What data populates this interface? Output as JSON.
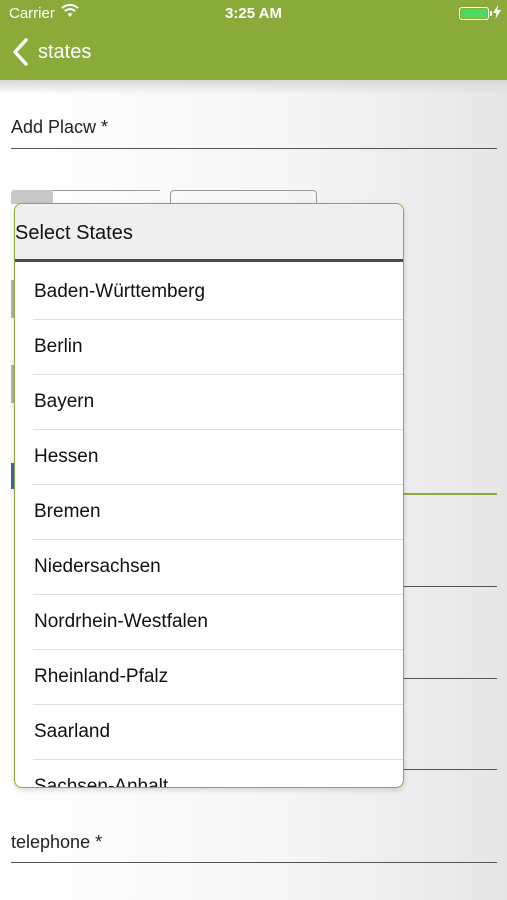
{
  "status_bar": {
    "carrier": "Carrier",
    "time": "3:25 AM"
  },
  "nav": {
    "back_label": "states"
  },
  "form": {
    "add_place_label": "Add Placw *",
    "telephone_label": "telephone *"
  },
  "picker": {
    "title": "Select States",
    "items": [
      "Baden-Württemberg",
      "Berlin",
      "Bayern",
      "Hessen",
      "Bremen",
      "Niedersachsen",
      "Nordrhein-Westfalen",
      "Rheinland-Pfalz",
      "Saarland",
      "Sachsen-Anhalt"
    ]
  },
  "colors": {
    "nav": "#8aaa3a",
    "accent": "#8aaa3a",
    "battery": "#4cd964"
  }
}
